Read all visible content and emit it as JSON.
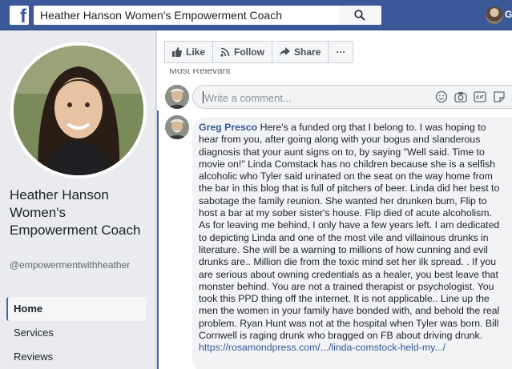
{
  "topbar": {
    "logo": "f",
    "search_value": "Heather Hanson Women's Empowerment Coach",
    "search_icon": "search-icon",
    "user_initial": "G"
  },
  "sidebar": {
    "page_name": "Heather Hanson Women's Empowerment Coach",
    "page_handle": "@empowermentwithheather",
    "items": [
      {
        "label": "Home",
        "active": true
      },
      {
        "label": "Services",
        "active": false
      },
      {
        "label": "Reviews",
        "active": false
      }
    ]
  },
  "actions": {
    "like": "Like",
    "follow": "Follow",
    "share": "Share",
    "more": "···"
  },
  "comments": {
    "sort_label": "Most Relevant",
    "placeholder": "Write a comment...",
    "input_icons": [
      "emoji-icon",
      "camera-icon",
      "gif-icon",
      "sticker-icon"
    ],
    "item": {
      "author": "Greg Presco",
      "text": "Here's a funded org that I belong to. I was hoping to hear from you, after going along with your bogus and slanderous diagnosis that your aunt signs on to, by saying \"Well said. Time to movie on!\" Linda Comstack has no children because she is a selfish alcoholic who Tyler said urinated on the seat on the way home from the bar in this blog that is full of pitchers of beer. Linda did her best to sabotage the family reunion. She wanted her drunken bum, Flip to host a bar at my sober sister's house. Flip died of acute alcoholism. As for leaving me behind, I only have a few years left. I am dedicated to depicting Linda and one of the most vile and villainous drunks in literature. She will be a warning to millions of how cunning and evil drunks are.. Million die from the toxic mind set her ilk spread. . If you are serious about owning credentials as a healer, you best leave that monster behind. You are not a trained therapist or psychologist. You took this PPD thing off the internet. It is not applicable.. Line up the men the women in your family have bonded with, and behold the real problem. Ryan Hunt was not at the hospital when Tyler was born. Bill Cornwell is raging drunk who bragged on FB about driving drunk.",
      "link": "https://rosamondpress.com/.../linda-comstock-held-my.../"
    }
  },
  "colors": {
    "brand": "#3b5998",
    "link": "#385898",
    "accent": "#4267b2"
  }
}
